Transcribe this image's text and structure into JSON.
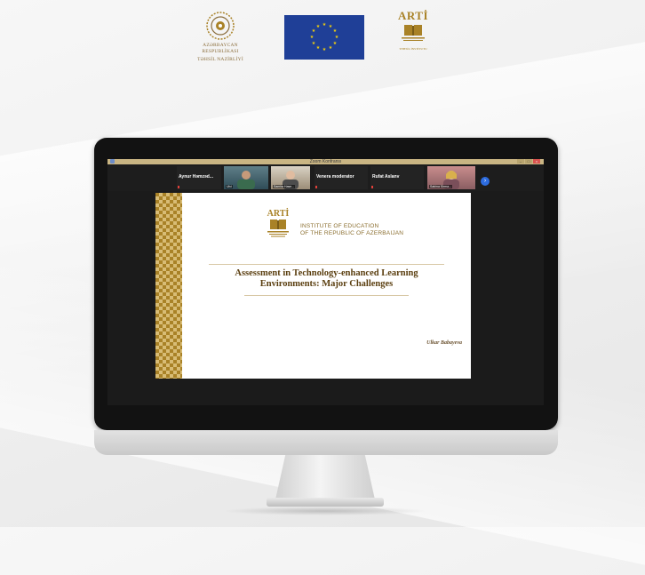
{
  "header_logos": {
    "ministry": {
      "line1": "AZƏRBAYCAN RESPUBLİKASI",
      "line2": "TƏHSİL NAZİRLİYİ",
      "icon": "ornament-emblem-icon"
    },
    "eu": {
      "icon": "eu-flag-icon",
      "color": "#1f3f97",
      "star_color": "#f5d20a"
    },
    "arti": {
      "word": "ARTİ",
      "caption": "TƏHSİL İNSTİTUTU",
      "icon": "open-book-icon",
      "color": "#a98227"
    }
  },
  "zoom": {
    "window_title": "Zoom Konfransı",
    "window_buttons": [
      "–",
      "□",
      "×"
    ],
    "participants": [
      {
        "type": "name",
        "name": "Aynur Həmzəd..."
      },
      {
        "type": "video",
        "label": "Ulvi"
      },
      {
        "type": "video",
        "label": "Samira Hase..."
      },
      {
        "type": "name",
        "name": "Venera moderator"
      },
      {
        "type": "name",
        "name": "Rufat Aslanv"
      },
      {
        "type": "video",
        "label": "Sabina Sirma..."
      }
    ],
    "next_page_icon": "chevron-right-icon"
  },
  "slide": {
    "logo_word": "ARTİ",
    "org_line1": "INSTITUTE OF EDUCATION",
    "org_line2": "OF THE REPUBLIC OF AZERBAIJAN",
    "title_line1": "Assessment in Technology-enhanced Learning",
    "title_line2": "Environments: Major Challenges",
    "author": "Ulkar Babayeva",
    "accent_color": "#a98227"
  }
}
